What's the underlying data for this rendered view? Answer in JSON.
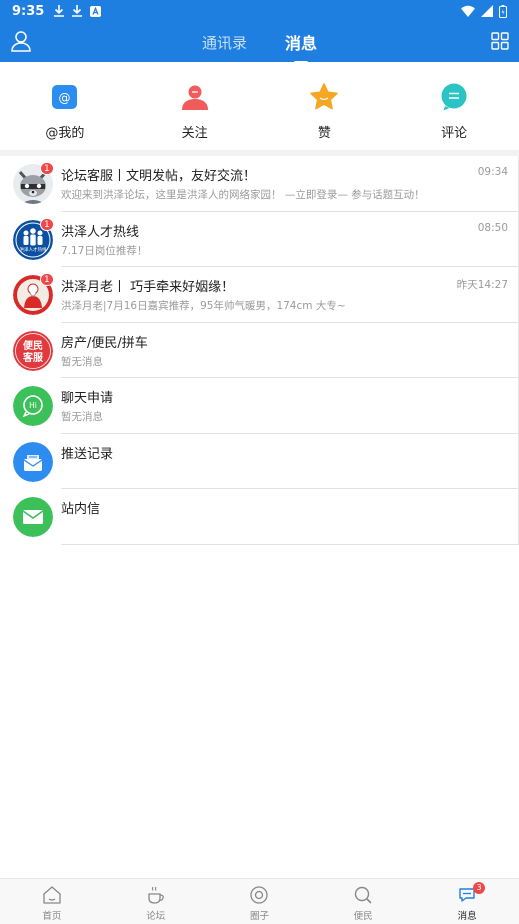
{
  "status_bar": {
    "time": "9:35"
  },
  "header": {
    "tabs": [
      {
        "label": "通讯录"
      },
      {
        "label": "消息"
      }
    ]
  },
  "quick_actions": [
    {
      "label": "@我的",
      "icon": "at-icon",
      "color": "#2d8cf0"
    },
    {
      "label": "关注",
      "icon": "person-icon",
      "color": "#f25b5b"
    },
    {
      "label": "赞",
      "icon": "star-icon",
      "color": "#f5a623"
    },
    {
      "label": "评论",
      "icon": "comment-icon",
      "color": "#2bc4c4"
    }
  ],
  "messages": [
    {
      "title": "论坛客服丨文明发帖，友好交流！",
      "subtitle": "欢迎来到洪泽论坛，这里是洪泽人的网络家园！ —立即登录— 参与话题互动！",
      "time": "09:34",
      "badge": "1"
    },
    {
      "title": "洪泽人才热线",
      "subtitle": "7.17日岗位推荐！",
      "time": "08:50",
      "badge": "1"
    },
    {
      "title": "洪泽月老丨 巧手牵来好姻缘！",
      "subtitle": "洪泽月老|7月16日嘉宾推荐，95年帅气暖男，174cm 大专~",
      "time": "昨天14:27",
      "badge": "1"
    },
    {
      "title": "房产/便民/拼车",
      "subtitle": "暂无消息",
      "time": "",
      "badge": ""
    },
    {
      "title": "聊天申请",
      "subtitle": "暂无消息",
      "time": "",
      "badge": ""
    },
    {
      "title": "推送记录",
      "subtitle": "",
      "time": "",
      "badge": ""
    },
    {
      "title": "站内信",
      "subtitle": "",
      "time": "",
      "badge": ""
    }
  ],
  "avatar_text": {
    "renzai": "洪泽人才热线",
    "bianmin_1": "便民",
    "bianmin_2": "客服",
    "chat": "Hi"
  },
  "bottom_nav": [
    {
      "label": "首页"
    },
    {
      "label": "论坛"
    },
    {
      "label": "圈子"
    },
    {
      "label": "便民"
    },
    {
      "label": "消息",
      "badge": "3"
    }
  ],
  "colors": {
    "primary": "#1f7fe0",
    "badge": "#f04848",
    "green": "#3cc05a"
  }
}
